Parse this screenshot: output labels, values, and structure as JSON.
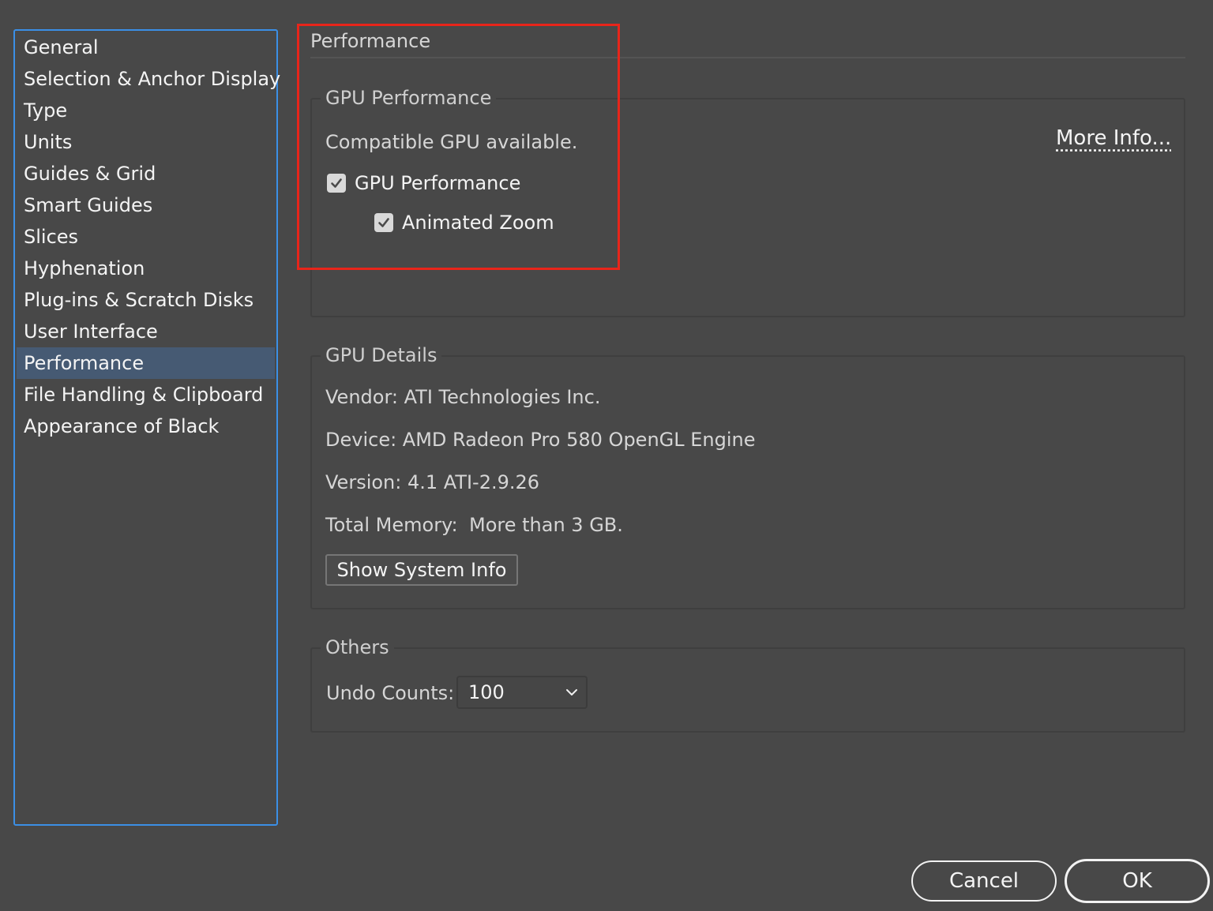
{
  "sidebar": {
    "items": [
      {
        "label": "General"
      },
      {
        "label": "Selection & Anchor Display"
      },
      {
        "label": "Type"
      },
      {
        "label": "Units"
      },
      {
        "label": "Guides & Grid"
      },
      {
        "label": "Smart Guides"
      },
      {
        "label": "Slices"
      },
      {
        "label": "Hyphenation"
      },
      {
        "label": "Plug-ins & Scratch Disks"
      },
      {
        "label": "User Interface"
      },
      {
        "label": "Performance"
      },
      {
        "label": "File Handling & Clipboard"
      },
      {
        "label": "Appearance of Black"
      }
    ],
    "selected": "Performance"
  },
  "main": {
    "title": "Performance",
    "gpu_performance": {
      "legend": "GPU Performance",
      "status": "Compatible GPU available.",
      "more_info": "More Info...",
      "gpu_checkbox_label": "GPU Performance",
      "gpu_checked": true,
      "zoom_checkbox_label": "Animated Zoom",
      "zoom_checked": true
    },
    "gpu_details": {
      "legend": "GPU Details",
      "vendor": "Vendor: ATI Technologies Inc.",
      "device": "Device: AMD Radeon Pro 580 OpenGL Engine",
      "version": "Version: 4.1 ATI-2.9.26",
      "total_memory_label": "Total Memory:",
      "total_memory_value": "More than 3 GB.",
      "show_system_info": "Show System Info"
    },
    "others": {
      "legend": "Others",
      "undo_counts_label": "Undo Counts:",
      "undo_counts_value": "100"
    }
  },
  "footer": {
    "cancel": "Cancel",
    "ok": "OK"
  },
  "colors": {
    "background": "#484848",
    "sidebar_border": "#3b8fe6",
    "selected_item": "#465a73",
    "annotation": "#e8251a"
  }
}
